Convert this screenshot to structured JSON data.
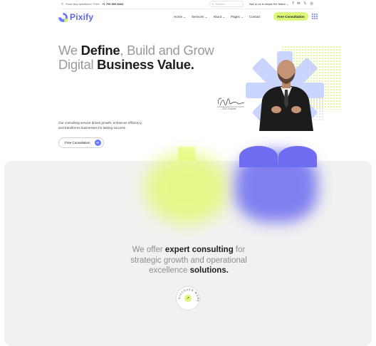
{
  "topbar": {
    "question": "Have any questions? Free:",
    "phone": "+1 700 809 8464",
    "search_placeholder": "Search...",
    "tagline": "Ask to us to shape the future",
    "social": [
      "f",
      "in",
      "𝕏",
      "◎"
    ]
  },
  "nav": {
    "brand": "Pixify",
    "items": [
      "Home",
      "Services",
      "About",
      "Pages",
      "Contact"
    ],
    "cta": "Free Consultation"
  },
  "hero": {
    "line1_light1": "We ",
    "line1_bold1": "Define",
    "line1_light2": ", Build and Grow",
    "line2_light": "Digital ",
    "line2_bold": "Business Value.",
    "desc_line1": "Our consulting service drives growth, enhances efficiency,",
    "desc_line2": "and transforms businesses for lasting success.",
    "cta": "Free Consultation",
    "signature_caption": "— CEO Founder"
  },
  "offer": {
    "p1": "We offer ",
    "b1": "expert consulting",
    "p2": " for",
    "line2": "strategic growth and operational",
    "line3_light": "excellence ",
    "line3_bold": "solutions.",
    "badge_text": "DISCOVER MORE"
  },
  "colors": {
    "accent": "#6b7bff",
    "lime": "#dcf77a",
    "gray_bg": "#f1f1f1"
  }
}
